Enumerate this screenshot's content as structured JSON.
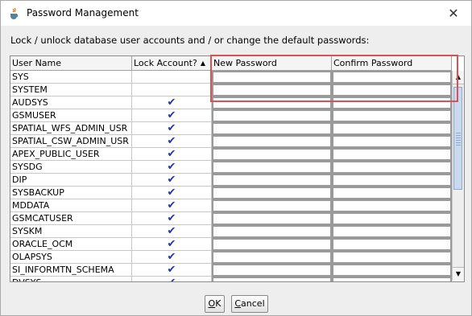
{
  "window": {
    "title": "Password Management",
    "close_glyph": "✕"
  },
  "instructions": "Lock / unlock database user accounts and / or change the default passwords:",
  "table": {
    "columns": {
      "user_name": "User Name",
      "lock_account": "Lock Account?",
      "new_password": "New Password",
      "confirm_password": "Confirm Password"
    },
    "sort_indicator": "▲",
    "rows": [
      {
        "user": "SYS",
        "locked": ""
      },
      {
        "user": "SYSTEM",
        "locked": ""
      },
      {
        "user": "AUDSYS",
        "locked": "✔"
      },
      {
        "user": "GSMUSER",
        "locked": "✔"
      },
      {
        "user": "SPATIAL_WFS_ADMIN_USR",
        "locked": "✔"
      },
      {
        "user": "SPATIAL_CSW_ADMIN_USR",
        "locked": "✔"
      },
      {
        "user": "APEX_PUBLIC_USER",
        "locked": "✔"
      },
      {
        "user": "SYSDG",
        "locked": "✔"
      },
      {
        "user": "DIP",
        "locked": "✔"
      },
      {
        "user": "SYSBACKUP",
        "locked": "✔"
      },
      {
        "user": "MDDATA",
        "locked": "✔"
      },
      {
        "user": "GSMCATUSER",
        "locked": "✔"
      },
      {
        "user": "SYSKM",
        "locked": "✔"
      },
      {
        "user": "ORACLE_OCM",
        "locked": "✔"
      },
      {
        "user": "OLAPSYS",
        "locked": "✔"
      },
      {
        "user": "SI_INFORMTN_SCHEMA",
        "locked": "✔"
      },
      {
        "user": "DVSYS",
        "locked": "✔"
      }
    ]
  },
  "scrollbar": {
    "up_glyph": "▲",
    "down_glyph": "▼"
  },
  "buttons": {
    "ok": "OK",
    "cancel": "Cancel"
  },
  "colors": {
    "check": "#1c32b4",
    "highlight": "#e05050",
    "thumb": "#c9d9ee"
  }
}
